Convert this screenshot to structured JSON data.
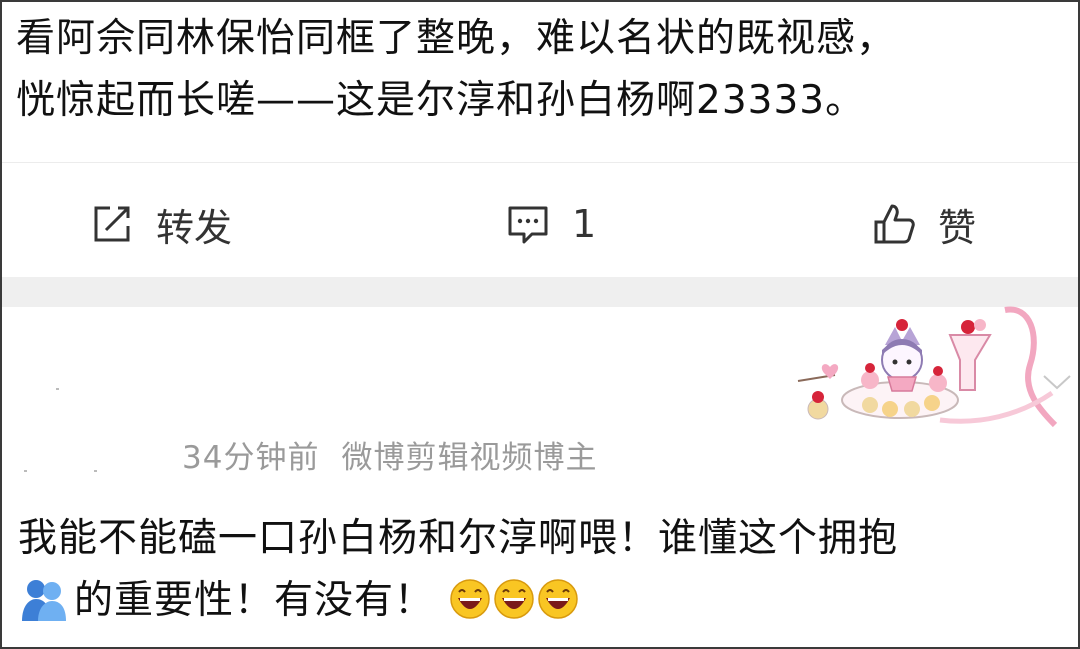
{
  "post": {
    "line1": "看阿佘同林保怡同框了整晚，难以名状的既视感，",
    "line2": "恍惊起而长嗟——这是尔淳和孙白杨啊23333。"
  },
  "actions": {
    "repost_label": "转发",
    "comment_count": "1",
    "like_label": "赞"
  },
  "comment": {
    "time": "34分钟前",
    "source": "微博剪辑视频博主",
    "line1": "我能不能磕一口孙白杨和尔淳啊喂！谁懂这个拥抱",
    "line2": "的重要性！有没有！"
  },
  "icons": {
    "repost": "repost-icon",
    "comment": "comment-icon",
    "like": "thumbs-up-icon",
    "hug": "hug-emoji",
    "laugh": "laughing-emoji",
    "chevron": "chevron-down-icon"
  },
  "colors": {
    "text": "#111111",
    "meta": "#9a9a9a",
    "band": "#efefef",
    "pink": "#f2a7c0",
    "purple": "#b7a3d6",
    "red": "#d6243a"
  }
}
